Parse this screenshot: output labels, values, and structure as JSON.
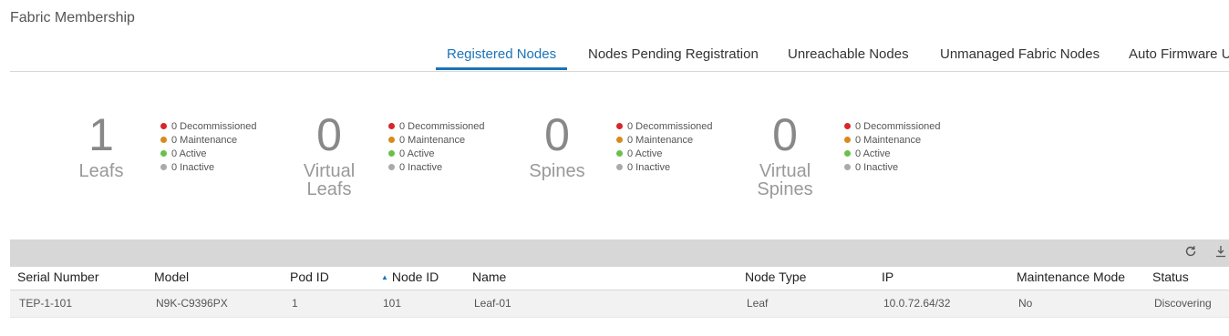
{
  "page_title": "Fabric Membership",
  "tabs": [
    {
      "label": "Registered Nodes",
      "active": true
    },
    {
      "label": "Nodes Pending Registration",
      "active": false
    },
    {
      "label": "Unreachable Nodes",
      "active": false
    },
    {
      "label": "Unmanaged Fabric Nodes",
      "active": false
    },
    {
      "label": "Auto Firmware U",
      "active": false
    }
  ],
  "status_colors": {
    "decommissioned": "#d7262c",
    "maintenance": "#d98a1b",
    "active": "#6cc04a",
    "inactive": "#aaaaaa"
  },
  "metrics": [
    {
      "count": "1",
      "label_line1": "Leafs",
      "label_line2": "",
      "legend": [
        "0 Decommissioned",
        "0 Maintenance",
        "0 Active",
        "0 Inactive"
      ]
    },
    {
      "count": "0",
      "label_line1": "Virtual",
      "label_line2": "Leafs",
      "legend": [
        "0 Decommissioned",
        "0 Maintenance",
        "0 Active",
        "0 Inactive"
      ]
    },
    {
      "count": "0",
      "label_line1": "Spines",
      "label_line2": "",
      "legend": [
        "0 Decommissioned",
        "0 Maintenance",
        "0 Active",
        "0 Inactive"
      ]
    },
    {
      "count": "0",
      "label_line1": "Virtual",
      "label_line2": "Spines",
      "legend": [
        "0 Decommissioned",
        "0 Maintenance",
        "0 Active",
        "0 Inactive"
      ]
    }
  ],
  "toolbar": {
    "refresh_icon": "refresh-icon",
    "download_icon": "download-icon"
  },
  "table": {
    "sorted_column": "Node ID",
    "sort_direction": "ascending",
    "columns": [
      "Serial Number",
      "Model",
      "Pod ID",
      "Node ID",
      "Name",
      "Node Type",
      "IP",
      "Maintenance Mode",
      "Status"
    ],
    "rows": [
      [
        "TEP-1-101",
        "N9K-C9396PX",
        "1",
        "101",
        "Leaf-01",
        "Leaf",
        "10.0.72.64/32",
        "No",
        "Discovering"
      ]
    ]
  }
}
